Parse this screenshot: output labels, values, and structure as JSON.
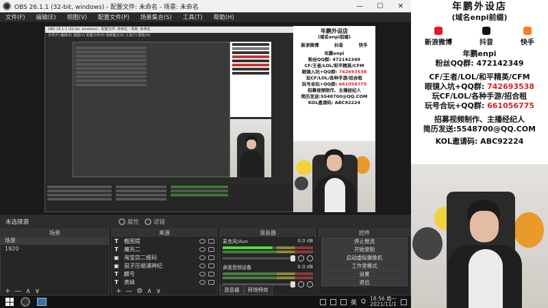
{
  "window": {
    "title": "OBS 26.1.1 (32-bit, windows) - 配置文件: 未命名 - 场景: 未命名",
    "min": "—",
    "max": "☐",
    "close": "✕"
  },
  "menu": [
    "文件(F)",
    "编辑(E)",
    "视图(V)",
    "配置文件(P)",
    "场景集合(S)",
    "工具(T)",
    "帮助(H)"
  ],
  "nested": {
    "title": "OBS 26.1.1 (32-bit, windows) - 配置文件: 未命名 - 场景: 未命名",
    "menu": "文件(F)  编辑(E)  视图(V)  配置文件(P)  场景集合(S)  工具(T)  帮助(H)"
  },
  "scene_bar": {
    "selection": "未选择源",
    "properties": "属性",
    "filters": "滤镜"
  },
  "scenes": {
    "header": "场景",
    "items": [
      "场景",
      "1920"
    ],
    "footer": [
      "+",
      "—",
      "∧",
      "∨"
    ]
  },
  "sources": {
    "header": "来源",
    "items": [
      {
        "icon": "T",
        "name": "截图提"
      },
      {
        "icon": "T",
        "name": "魔兆二"
      },
      {
        "icon": "▣",
        "name": "淘宝店二维码"
      },
      {
        "icon": "▣",
        "name": "鼠子压缩浦神纪"
      },
      {
        "icon": "T",
        "name": "麟号"
      },
      {
        "icon": "T",
        "name": "表妹"
      }
    ],
    "footer": [
      "+",
      "—",
      "⚙",
      "∧",
      "∨"
    ]
  },
  "mixer": {
    "header": "混音器",
    "channels": [
      {
        "name": "麦克风/Aux",
        "db": "0.0 dB"
      },
      {
        "name": "桌面音频设备",
        "db": "0.0 dB"
      }
    ],
    "tabs": [
      "混音器",
      "转场特效"
    ]
  },
  "controls": {
    "header": "控件",
    "buttons": [
      "停止推流",
      "开始录制",
      "启动虚拟摄像机",
      "工作室模式",
      "设置",
      "退出"
    ]
  },
  "taskbar": {
    "time": "18:56 周一",
    "date": "2021/11/1",
    "ime": "英",
    "qq": "Q"
  },
  "banner": {
    "shop": "年鹏外设店",
    "domain": "(域名enpi前缀)",
    "socials": [
      {
        "label": "新浪微博",
        "icon": "weibo-icon",
        "color": "#e6162d"
      },
      {
        "label": "抖音",
        "icon": "douyin-icon",
        "color": "#111111"
      },
      {
        "label": "快手",
        "icon": "kuaishou-icon",
        "color": "#ff7a1a"
      }
    ],
    "name": "年鹏enpi",
    "fans_label": "粉丝QQ群: ",
    "fans_qq": "472142349",
    "line1": "CF/王者/LOL/和平精英/CFM",
    "line2_a": "眼镜入坑+QQ群: ",
    "line2_b": "742693538",
    "line3": "玩CF/LOL/各种手游/招合租",
    "line4_a": "玩号合玩+QQ群: ",
    "line4_b": "661056775",
    "line5": "招募视频制作、主播经纪人",
    "line6": "简历发送:5548700@QQ.COM",
    "line7": "KOL邀请码: ABC92224"
  },
  "small_banner": {
    "shop": "年鹏外设店",
    "domain": "(域名enpi前缀)",
    "socials": [
      "新浪微博",
      "抖音",
      "快手"
    ],
    "name": "年鹏enpi",
    "fans": "粉丝QQ群: 472142349",
    "line1": "CF/王者/LOL/和平精英/CFM",
    "line2_a": "眼镜入坑+QQ群: ",
    "line2_b": "742693538",
    "line3": "玩CF/LOL/各种手游/招合租",
    "line4_a": "玩号合玩+QQ群: ",
    "line4_b": "661056775",
    "line5": "招募视频制作、主播经纪人",
    "line6": "简历发送:5548700@QQ.COM",
    "line7": "KOL邀请码: ABC92224"
  }
}
